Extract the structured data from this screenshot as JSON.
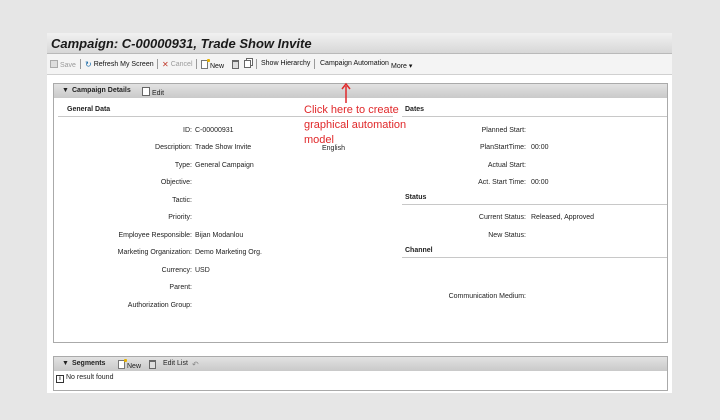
{
  "window": {
    "title": "Campaign: C-00000931, Trade Show Invite"
  },
  "toolbar": {
    "save": "Save",
    "refresh": "Refresh My Screen",
    "cancel": "Cancel",
    "new": "New",
    "show_hierarchy": "Show Hierarchy",
    "campaign_automation": "Campaign Automation",
    "more": "More"
  },
  "details_panel": {
    "title": "Campaign Details",
    "edit": "Edit"
  },
  "annotation": {
    "text": "Click here to create graphical automation model"
  },
  "general_data": {
    "heading": "General Data",
    "fields": {
      "id": {
        "label": "ID:",
        "value": "C-00000931"
      },
      "description": {
        "label": "Description:",
        "value": "Trade Show Invite",
        "language": "English"
      },
      "type": {
        "label": "Type:",
        "value": "General Campaign"
      },
      "objective": {
        "label": "Objective:",
        "value": ""
      },
      "tactic": {
        "label": "Tactic:",
        "value": ""
      },
      "priority": {
        "label": "Priority:",
        "value": ""
      },
      "employee_responsible": {
        "label": "Employee Responsible:",
        "value": "Bijan Modanlou"
      },
      "marketing_org": {
        "label": "Marketing Organization:",
        "value": "Demo Marketing Org."
      },
      "currency": {
        "label": "Currency:",
        "value": "USD"
      },
      "parent": {
        "label": "Parent:",
        "value": ""
      },
      "authorization_group": {
        "label": "Authorization Group:",
        "value": ""
      }
    }
  },
  "dates": {
    "heading": "Dates",
    "fields": {
      "planned_start": {
        "label": "Planned Start:",
        "value": ""
      },
      "plan_start_time": {
        "label": "PlanStartTime:",
        "value": "00:00"
      },
      "actual_start": {
        "label": "Actual Start:",
        "value": ""
      },
      "act_start_time": {
        "label": "Act. Start Time:",
        "value": "00:00"
      }
    }
  },
  "status": {
    "heading": "Status",
    "fields": {
      "current_status": {
        "label": "Current Status:",
        "value": "Released, Approved"
      },
      "new_status": {
        "label": "New Status:",
        "value": ""
      }
    }
  },
  "channel": {
    "heading": "Channel",
    "fields": {
      "communication_medium": {
        "label": "Communication Medium:",
        "value": ""
      }
    }
  },
  "segments": {
    "title": "Segments",
    "new": "New",
    "edit_list": "Edit List",
    "empty_message": "No result found"
  },
  "colors": {
    "highlight": "#e0282a",
    "panel_bar": "#d4d4d4",
    "background": "#e6e6e6"
  }
}
